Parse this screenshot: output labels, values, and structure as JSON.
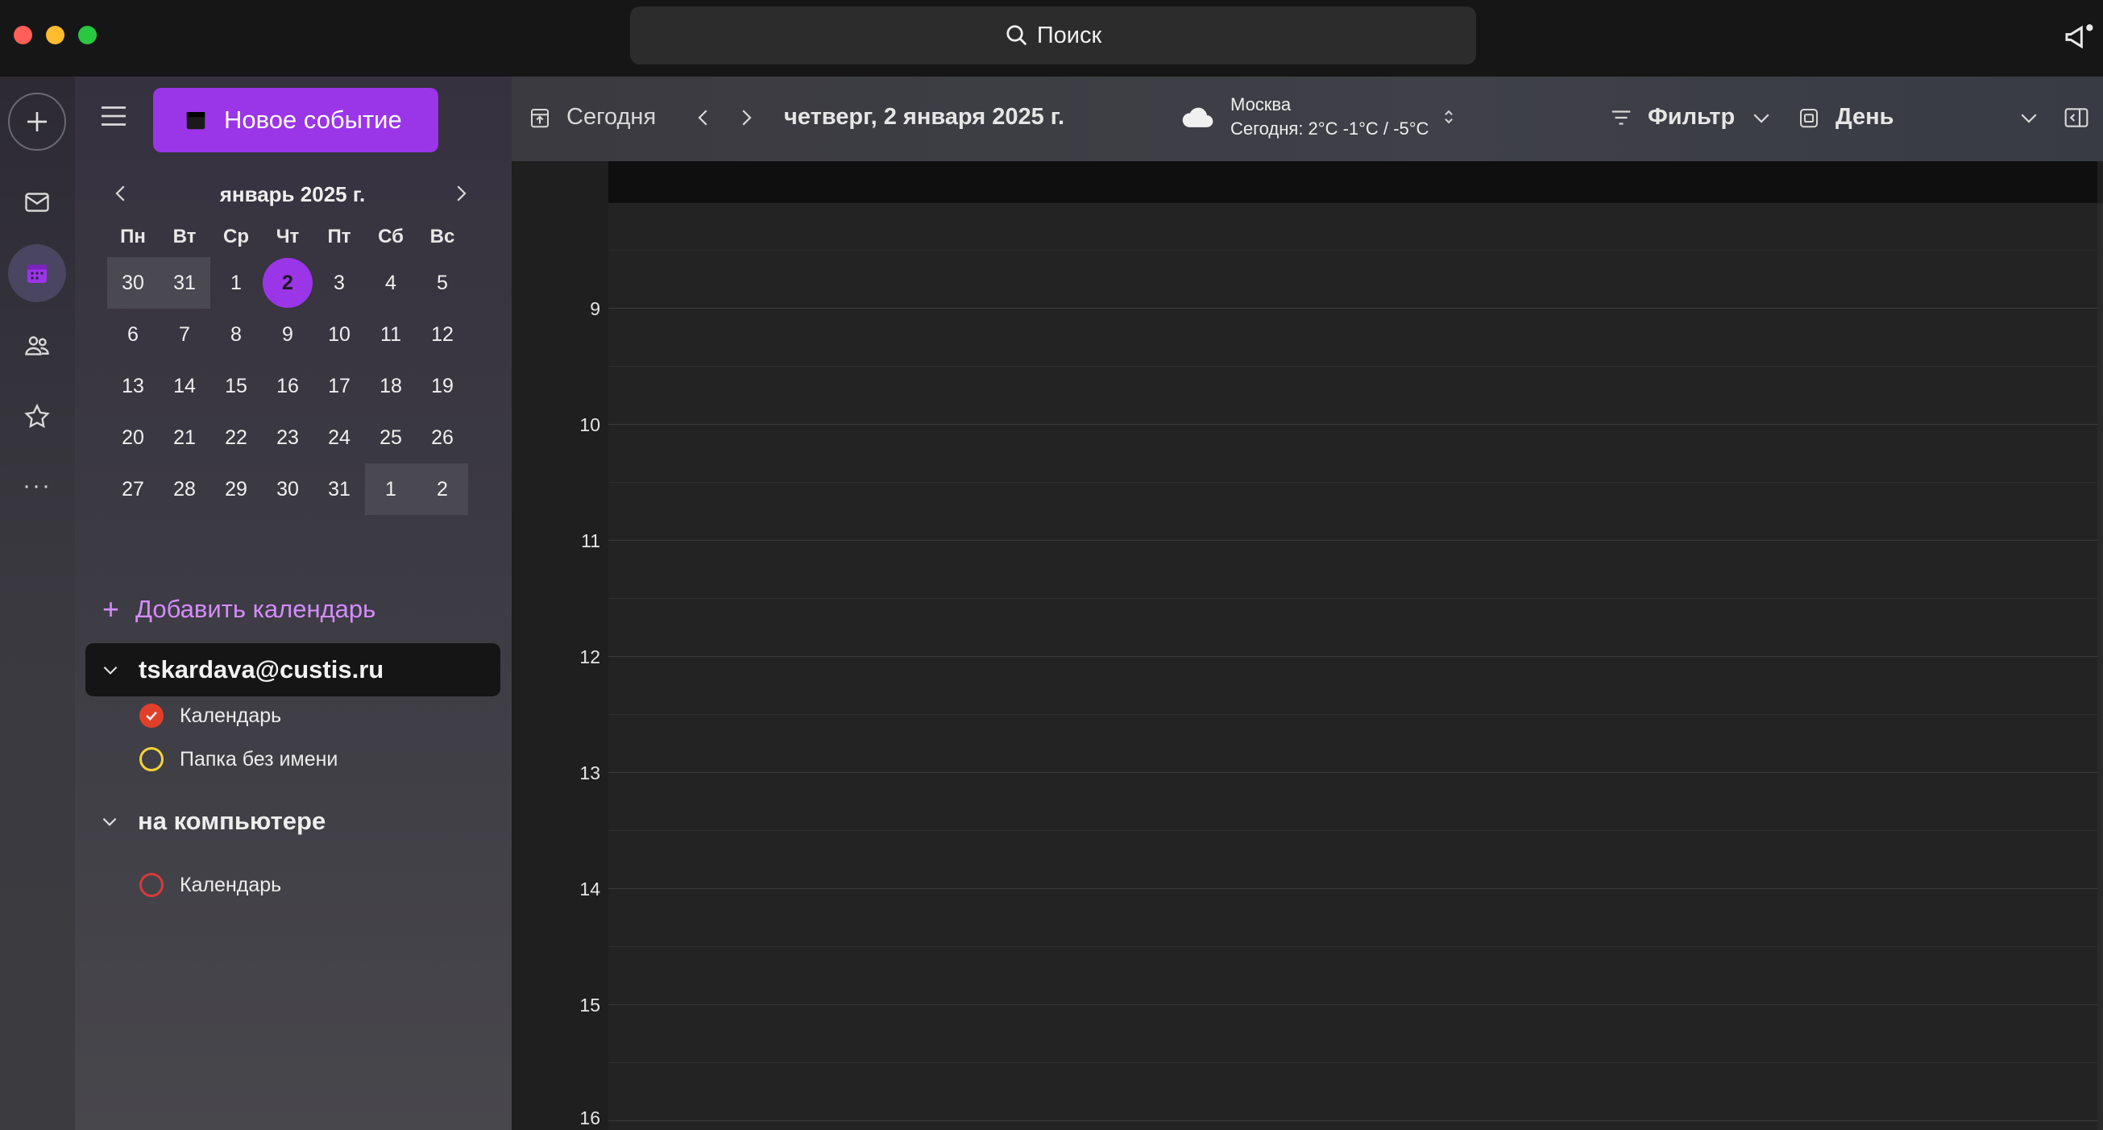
{
  "titlebar": {
    "search_placeholder": "Поиск"
  },
  "toolbar": {
    "new_event_label": "Новое событие",
    "today_label": "Сегодня",
    "date_title": "четверг, 2 января 2025 г.",
    "weather_city": "Москва",
    "weather_today": "Сегодня: 2°C  -1°C / -5°C",
    "filter_label": "Фильтр",
    "view_label": "День"
  },
  "mini_calendar": {
    "month_label": "январь 2025 г.",
    "weekdays": [
      "Пн",
      "Вт",
      "Ср",
      "Чт",
      "Пт",
      "Сб",
      "Вс"
    ],
    "weeks": [
      [
        "30",
        "31",
        "1",
        "2",
        "3",
        "4",
        "5"
      ],
      [
        "6",
        "7",
        "8",
        "9",
        "10",
        "11",
        "12"
      ],
      [
        "13",
        "14",
        "15",
        "16",
        "17",
        "18",
        "19"
      ],
      [
        "20",
        "21",
        "22",
        "23",
        "24",
        "25",
        "26"
      ],
      [
        "27",
        "28",
        "29",
        "30",
        "31",
        "1",
        "2"
      ]
    ],
    "selected_day": "2"
  },
  "sidebar": {
    "add_calendar_label": "Добавить календарь",
    "account_name": "tskardava@custis.ru",
    "account_calendars": [
      {
        "label": "Календарь",
        "color": "#e0402a"
      },
      {
        "label": "Папка без имени",
        "color": "#f5d33a"
      }
    ],
    "local_group_label": "на компьютере",
    "local_calendars": [
      {
        "label": "Календарь",
        "color": "#d63a3a"
      }
    ]
  },
  "day_view": {
    "hours": [
      "9",
      "10",
      "11",
      "12",
      "13",
      "14",
      "15",
      "16"
    ]
  },
  "colors": {
    "accent": "#9b35e8",
    "add_calendar_text": "#d58cff"
  }
}
